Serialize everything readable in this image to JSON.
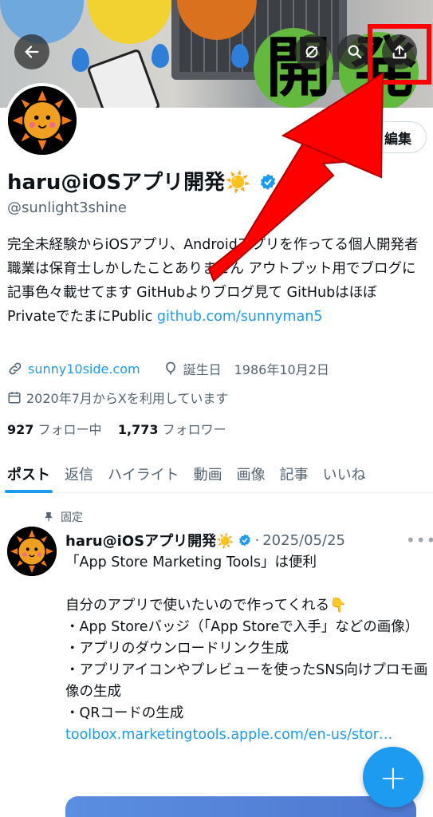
{
  "header": {
    "banner_overlay_text": [
      "開",
      "発"
    ],
    "buttons": [
      "back-icon",
      "grok-icon",
      "search-icon",
      "share-icon"
    ]
  },
  "profile": {
    "display_name": "haru@iOSアプリ開発",
    "name_emoji": "☀️",
    "handle": "@sunlight3shine",
    "edit_label": "編集",
    "bio_text": "完全未経験からiOSアプリ、Androidアプリを作ってる個人開発者 職業は保育士しかしたことありません アウトプット用でブログに記事色々載せてます GitHubよりブログ見て GitHubはほぼPrivateでたまにPublic ",
    "bio_link": "github.com/sunnyman5",
    "website": "sunny10side.com",
    "birthday": "誕生日　1986年10月2日",
    "joined": "2020年7月からXを利用しています",
    "following_count": "927",
    "following_label": "フォロー中",
    "followers_count": "1,773",
    "followers_label": "フォロワー"
  },
  "tabs": [
    "ポスト",
    "返信",
    "ハイライト",
    "動画",
    "画像",
    "記事",
    "いいね"
  ],
  "active_tab": "ポスト",
  "pinned_post": {
    "pinned_label": "固定",
    "author": "haru@iOSアプリ開発☀️",
    "date": "2025/05/25",
    "text": "「App Store Marketing Tools」は便利\n\n自分のアプリで使いたいので作ってくれる👇\n・App Storeバッジ（「App Storeで入手」などの画像）\n・アプリのダウンロードリンク生成\n・アプリアイコンやプレビューを使ったSNS向けプロモ画像の生成\n・QRコードの生成\n",
    "link": "toolbox.marketingtools.apple.com/en-us/stor…"
  },
  "fab_label": "+",
  "colors": {
    "accent": "#1d9bf0",
    "highlight": "#ff0000"
  }
}
